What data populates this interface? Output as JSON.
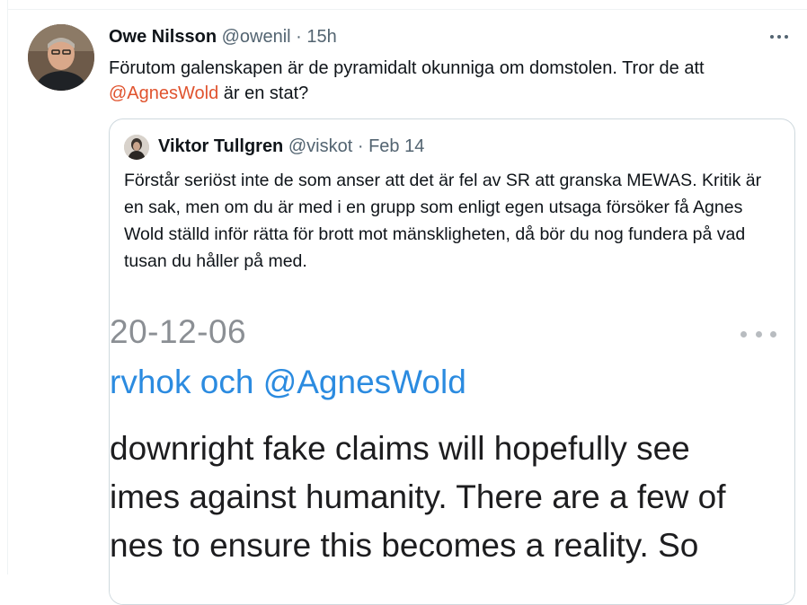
{
  "tweet": {
    "author_name": "Owe Nilsson",
    "author_handle": "@owenil",
    "separator": "·",
    "time": "15h",
    "text_before": "Förutom galenskapen är de pyramidalt okunniga om domstolen. Tror de att ",
    "mention": "@AgnesWold",
    "text_after": " är en stat?"
  },
  "quote": {
    "author_name": "Viktor Tullgren",
    "author_handle": "@viskot",
    "separator": "·",
    "date": "Feb 14",
    "text": "Förstår seriöst inte de som anser att det är fel av SR att granska MEWAS. Kritik är en sak, men om du är med i en grupp som enligt egen utsaga försöker få Agnes Wold ställd inför rätta för brott mot mänskligheten, då bör du nog fundera på vad tusan du håller på med."
  },
  "media": {
    "date": "20-12-06",
    "reply_line": "rvhok och @AgnesWold",
    "lines": [
      "downright fake claims will hopefully see",
      "imes against humanity. There are a few of",
      "nes to ensure this becomes a reality. So"
    ]
  },
  "icons": {
    "more": "more-horizontal-icon"
  },
  "colors": {
    "mention": "#e0532e",
    "secondary_text": "#536471",
    "media_link": "#2b8be0"
  }
}
